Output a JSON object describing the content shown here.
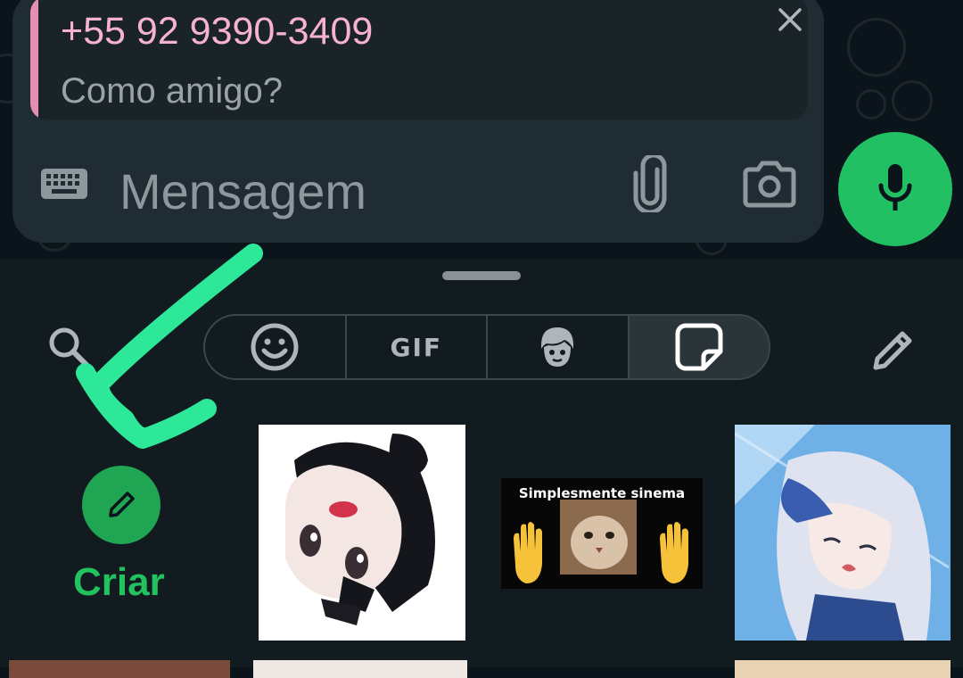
{
  "reply": {
    "name": "+55 92 9390-3409",
    "text": "Como amigo?"
  },
  "composer": {
    "placeholder": "Mensagem"
  },
  "icons": {
    "keyboard": "keyboard-icon",
    "attach": "paperclip-icon",
    "camera": "camera-icon",
    "mic": "microphone-icon",
    "close": "close-icon",
    "search": "search-icon",
    "emoji": "emoji-icon",
    "avatar": "avatar-icon",
    "sticker": "sticker-icon",
    "edit": "pencil-icon"
  },
  "tabs": [
    {
      "id": "emoji",
      "label": ""
    },
    {
      "id": "gif",
      "label": "GIF"
    },
    {
      "id": "avatar",
      "label": ""
    },
    {
      "id": "stickers",
      "label": "",
      "active": true
    }
  ],
  "create": {
    "label": "Criar"
  },
  "stickers": [
    {
      "name": "anime-girl-sticker"
    },
    {
      "name": "cat-cinema-sticker",
      "caption": "Simplesmente sinema"
    },
    {
      "name": "anime-white-hair-sticker"
    }
  ],
  "colors": {
    "accent_green": "#21c063",
    "reply_pink": "#e68fb0",
    "annotation_arrow": "#2ee89a"
  }
}
